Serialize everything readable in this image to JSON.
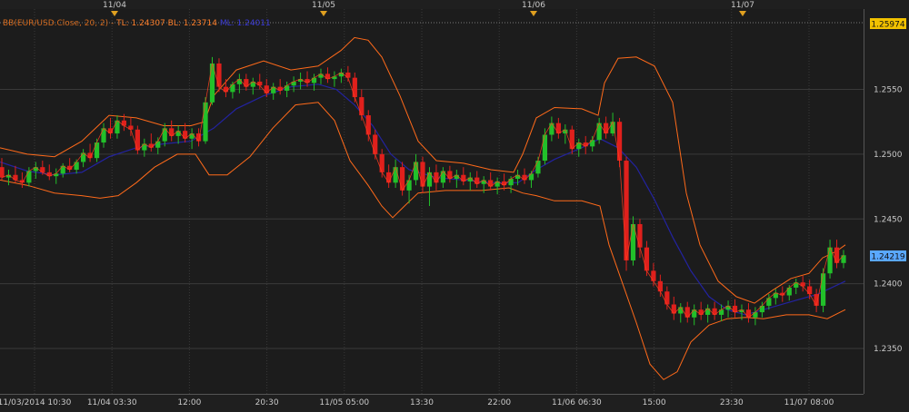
{
  "window": {
    "background": "#1f1f1f",
    "plot_background": "#1c1c1c",
    "grid_color": "#3a3a3a"
  },
  "legend": {
    "prefix": "BB(EUR/USD.Close, 20, 2)",
    "tl_label": "TL: 1.24307",
    "bl_label": "BL: 1.23714",
    "ml_label": "ML: 1.24011",
    "colors": {
      "prefix": "#d2691e",
      "tl": "#ff7f2a",
      "bl": "#ff7f2a",
      "ml": "#3b3bd9"
    }
  },
  "top_date_markers": [
    "11/04",
    "11/05",
    "11/06",
    "11/07"
  ],
  "price_badges": {
    "top": "1.25974",
    "last": "1.24219",
    "top_color": "#f2c200",
    "last_color": "#5aa8ff"
  },
  "chart_data": {
    "type": "candlestick",
    "title": "",
    "ylim": [
      1.2315,
      1.2612
    ],
    "y_ticks": [
      "1.2550",
      "1.2500",
      "1.2450",
      "1.2400",
      "1.2350"
    ],
    "x_ticks": [
      "11/03/2014 10:30",
      "11/04 03:30",
      "12:00",
      "20:30",
      "11/05 05:00",
      "13:30",
      "22:00",
      "11/06 06:30",
      "15:00",
      "23:30",
      "11/07 08:00"
    ],
    "up_color": "#22c02a",
    "down_color": "#e0201c",
    "upper_band_color": "#ff6a1a",
    "lower_band_color": "#ff6a1a",
    "mid_band_color": "#2323a0",
    "price_line_color": "#ff4020",
    "candles": [
      [
        1.249,
        1.2497,
        1.248,
        1.2482
      ],
      [
        1.2482,
        1.2488,
        1.2476,
        1.2484
      ],
      [
        1.2484,
        1.2491,
        1.2478,
        1.248
      ],
      [
        1.248,
        1.2486,
        1.2474,
        1.2478
      ],
      [
        1.2478,
        1.249,
        1.2475,
        1.2487
      ],
      [
        1.2487,
        1.2494,
        1.2481,
        1.249
      ],
      [
        1.249,
        1.2495,
        1.2484,
        1.2486
      ],
      [
        1.2486,
        1.2492,
        1.248,
        1.2483
      ],
      [
        1.2483,
        1.2489,
        1.2477,
        1.2485
      ],
      [
        1.2485,
        1.2493,
        1.2482,
        1.2491
      ],
      [
        1.2491,
        1.2497,
        1.2486,
        1.2488
      ],
      [
        1.2488,
        1.2496,
        1.2485,
        1.2494
      ],
      [
        1.2494,
        1.2504,
        1.249,
        1.2501
      ],
      [
        1.2501,
        1.2508,
        1.2494,
        1.2497
      ],
      [
        1.2497,
        1.2512,
        1.2494,
        1.2509
      ],
      [
        1.2509,
        1.2524,
        1.2505,
        1.252
      ],
      [
        1.252,
        1.2528,
        1.2512,
        1.2516
      ],
      [
        1.2516,
        1.253,
        1.2512,
        1.2526
      ],
      [
        1.2526,
        1.2531,
        1.2518,
        1.2522
      ],
      [
        1.2522,
        1.2528,
        1.2514,
        1.2519
      ],
      [
        1.2519,
        1.2522,
        1.25,
        1.2503
      ],
      [
        1.2503,
        1.2512,
        1.2498,
        1.2508
      ],
      [
        1.2508,
        1.2516,
        1.2502,
        1.2505
      ],
      [
        1.2505,
        1.2513,
        1.25,
        1.251
      ],
      [
        1.251,
        1.2524,
        1.2506,
        1.252
      ],
      [
        1.252,
        1.2526,
        1.251,
        1.2514
      ],
      [
        1.2514,
        1.2522,
        1.2508,
        1.2518
      ],
      [
        1.2518,
        1.2524,
        1.2509,
        1.2512
      ],
      [
        1.2512,
        1.252,
        1.2504,
        1.2516
      ],
      [
        1.2516,
        1.252,
        1.2506,
        1.251
      ],
      [
        1.251,
        1.2544,
        1.2508,
        1.254
      ],
      [
        1.254,
        1.2575,
        1.2538,
        1.257
      ],
      [
        1.257,
        1.2574,
        1.2548,
        1.2552
      ],
      [
        1.2552,
        1.2558,
        1.2544,
        1.2548
      ],
      [
        1.2548,
        1.2556,
        1.2543,
        1.2554
      ],
      [
        1.2554,
        1.2562,
        1.2547,
        1.2558
      ],
      [
        1.2558,
        1.2562,
        1.2549,
        1.2552
      ],
      [
        1.2552,
        1.2559,
        1.2546,
        1.2556
      ],
      [
        1.2556,
        1.2562,
        1.255,
        1.2553
      ],
      [
        1.2553,
        1.2558,
        1.2544,
        1.2547
      ],
      [
        1.2547,
        1.2555,
        1.2542,
        1.2552
      ],
      [
        1.2552,
        1.2558,
        1.2546,
        1.2549
      ],
      [
        1.2549,
        1.2556,
        1.2544,
        1.2553
      ],
      [
        1.2553,
        1.256,
        1.2548,
        1.2556
      ],
      [
        1.2556,
        1.2563,
        1.255,
        1.2558
      ],
      [
        1.2558,
        1.2564,
        1.2552,
        1.2555
      ],
      [
        1.2555,
        1.2562,
        1.2549,
        1.2559
      ],
      [
        1.2559,
        1.2566,
        1.2554,
        1.2562
      ],
      [
        1.2562,
        1.2567,
        1.2555,
        1.2558
      ],
      [
        1.2558,
        1.2564,
        1.2552,
        1.256
      ],
      [
        1.256,
        1.2566,
        1.2555,
        1.2563
      ],
      [
        1.2563,
        1.2568,
        1.2556,
        1.2559
      ],
      [
        1.2559,
        1.2563,
        1.254,
        1.2544
      ],
      [
        1.2544,
        1.255,
        1.2526,
        1.253
      ],
      [
        1.253,
        1.2534,
        1.251,
        1.2515
      ],
      [
        1.2515,
        1.2519,
        1.2496,
        1.25
      ],
      [
        1.25,
        1.2504,
        1.2482,
        1.2486
      ],
      [
        1.2486,
        1.2492,
        1.2474,
        1.2478
      ],
      [
        1.2478,
        1.2496,
        1.2474,
        1.249
      ],
      [
        1.249,
        1.2494,
        1.2468,
        1.2472
      ],
      [
        1.2472,
        1.2484,
        1.2462,
        1.248
      ],
      [
        1.248,
        1.25,
        1.2476,
        1.2494
      ],
      [
        1.2494,
        1.2498,
        1.247,
        1.2475
      ],
      [
        1.2475,
        1.249,
        1.246,
        1.2486
      ],
      [
        1.2486,
        1.2492,
        1.2472,
        1.2478
      ],
      [
        1.2478,
        1.249,
        1.2474,
        1.2487
      ],
      [
        1.2487,
        1.2491,
        1.2478,
        1.2481
      ],
      [
        1.2481,
        1.2488,
        1.2474,
        1.2484
      ],
      [
        1.2484,
        1.249,
        1.2476,
        1.2479
      ],
      [
        1.2479,
        1.2486,
        1.2472,
        1.2482
      ],
      [
        1.2482,
        1.2487,
        1.2474,
        1.2477
      ],
      [
        1.2477,
        1.2483,
        1.247,
        1.248
      ],
      [
        1.248,
        1.2486,
        1.2472,
        1.2475
      ],
      [
        1.2475,
        1.2482,
        1.2469,
        1.2479
      ],
      [
        1.2479,
        1.2485,
        1.2472,
        1.2476
      ],
      [
        1.2476,
        1.2483,
        1.247,
        1.2481
      ],
      [
        1.2481,
        1.2488,
        1.2476,
        1.2484
      ],
      [
        1.2484,
        1.2489,
        1.2477,
        1.248
      ],
      [
        1.248,
        1.2487,
        1.2474,
        1.2485
      ],
      [
        1.2485,
        1.2498,
        1.2482,
        1.2495
      ],
      [
        1.2495,
        1.252,
        1.2492,
        1.2515
      ],
      [
        1.2515,
        1.2529,
        1.251,
        1.2524
      ],
      [
        1.2524,
        1.2528,
        1.2512,
        1.2516
      ],
      [
        1.2516,
        1.2523,
        1.2508,
        1.2519
      ],
      [
        1.2519,
        1.2522,
        1.25,
        1.2504
      ],
      [
        1.2504,
        1.2512,
        1.2498,
        1.2509
      ],
      [
        1.2509,
        1.2514,
        1.25,
        1.2506
      ],
      [
        1.2506,
        1.2514,
        1.2502,
        1.2511
      ],
      [
        1.2511,
        1.2528,
        1.2508,
        1.2524
      ],
      [
        1.2524,
        1.2529,
        1.2512,
        1.2516
      ],
      [
        1.2516,
        1.2532,
        1.2514,
        1.2525
      ],
      [
        1.2525,
        1.2528,
        1.249,
        1.2495
      ],
      [
        1.2495,
        1.2498,
        1.241,
        1.2418
      ],
      [
        1.2418,
        1.2452,
        1.2414,
        1.2446
      ],
      [
        1.2446,
        1.245,
        1.242,
        1.2428
      ],
      [
        1.2428,
        1.2433,
        1.2406,
        1.241
      ],
      [
        1.241,
        1.2416,
        1.2398,
        1.2402
      ],
      [
        1.2402,
        1.2407,
        1.239,
        1.2394
      ],
      [
        1.2394,
        1.2398,
        1.238,
        1.2384
      ],
      [
        1.2384,
        1.239,
        1.2372,
        1.2377
      ],
      [
        1.2377,
        1.2385,
        1.237,
        1.2382
      ],
      [
        1.2382,
        1.2386,
        1.237,
        1.2374
      ],
      [
        1.2374,
        1.2384,
        1.2368,
        1.238
      ],
      [
        1.238,
        1.2386,
        1.2372,
        1.2376
      ],
      [
        1.2376,
        1.2384,
        1.237,
        1.2381
      ],
      [
        1.2381,
        1.2386,
        1.2372,
        1.2376
      ],
      [
        1.2376,
        1.2384,
        1.2371,
        1.238
      ],
      [
        1.238,
        1.2387,
        1.2374,
        1.2383
      ],
      [
        1.2383,
        1.2388,
        1.2374,
        1.2378
      ],
      [
        1.2378,
        1.2384,
        1.2372,
        1.238
      ],
      [
        1.238,
        1.2385,
        1.237,
        1.2374
      ],
      [
        1.2374,
        1.2382,
        1.2368,
        1.2378
      ],
      [
        1.2378,
        1.2386,
        1.2374,
        1.2383
      ],
      [
        1.2383,
        1.2392,
        1.238,
        1.2389
      ],
      [
        1.2389,
        1.2396,
        1.2384,
        1.2393
      ],
      [
        1.2393,
        1.2398,
        1.2386,
        1.2391
      ],
      [
        1.2391,
        1.2399,
        1.2387,
        1.2397
      ],
      [
        1.2397,
        1.2404,
        1.2392,
        1.2401
      ],
      [
        1.2401,
        1.2406,
        1.2394,
        1.2398
      ],
      [
        1.2398,
        1.2403,
        1.2388,
        1.2392
      ],
      [
        1.2392,
        1.2396,
        1.2378,
        1.2383
      ],
      [
        1.2383,
        1.2412,
        1.2378,
        1.2408
      ],
      [
        1.2408,
        1.2434,
        1.2404,
        1.2428
      ],
      [
        1.2428,
        1.2434,
        1.2412,
        1.2416
      ],
      [
        1.2416,
        1.2426,
        1.2412,
        1.2422
      ]
    ],
    "upper_band": [
      [
        0,
        1.2505
      ],
      [
        30,
        1.25
      ],
      [
        60,
        1.2498
      ],
      [
        90,
        1.251
      ],
      [
        120,
        1.253
      ],
      [
        150,
        1.2528
      ],
      [
        180,
        1.2522
      ],
      [
        210,
        1.2522
      ],
      [
        225,
        1.2525
      ],
      [
        235,
        1.2545
      ],
      [
        260,
        1.2565
      ],
      [
        290,
        1.2572
      ],
      [
        320,
        1.2565
      ],
      [
        350,
        1.2568
      ],
      [
        375,
        1.258
      ],
      [
        390,
        1.259
      ],
      [
        405,
        1.2588
      ],
      [
        420,
        1.2575
      ],
      [
        440,
        1.2545
      ],
      [
        460,
        1.251
      ],
      [
        480,
        1.2495
      ],
      [
        510,
        1.2493
      ],
      [
        540,
        1.2488
      ],
      [
        565,
        1.2486
      ],
      [
        575,
        1.25
      ],
      [
        590,
        1.2528
      ],
      [
        610,
        1.2536
      ],
      [
        640,
        1.2535
      ],
      [
        658,
        1.253
      ],
      [
        665,
        1.2555
      ],
      [
        680,
        1.2574
      ],
      [
        700,
        1.2575
      ],
      [
        720,
        1.2568
      ],
      [
        740,
        1.254
      ],
      [
        755,
        1.247
      ],
      [
        770,
        1.243
      ],
      [
        790,
        1.2402
      ],
      [
        810,
        1.239
      ],
      [
        830,
        1.2385
      ],
      [
        850,
        1.2395
      ],
      [
        870,
        1.2404
      ],
      [
        890,
        1.2408
      ],
      [
        905,
        1.242
      ],
      [
        920,
        1.2425
      ],
      [
        930,
        1.243
      ]
    ],
    "lower_band": [
      [
        0,
        1.248
      ],
      [
        30,
        1.2476
      ],
      [
        60,
        1.247
      ],
      [
        90,
        1.2468
      ],
      [
        110,
        1.2466
      ],
      [
        130,
        1.2468
      ],
      [
        150,
        1.2478
      ],
      [
        170,
        1.249
      ],
      [
        195,
        1.25
      ],
      [
        215,
        1.25
      ],
      [
        230,
        1.2484
      ],
      [
        250,
        1.2484
      ],
      [
        275,
        1.2498
      ],
      [
        300,
        1.252
      ],
      [
        325,
        1.2538
      ],
      [
        350,
        1.254
      ],
      [
        368,
        1.2526
      ],
      [
        385,
        1.2495
      ],
      [
        405,
        1.2476
      ],
      [
        420,
        1.246
      ],
      [
        432,
        1.2451
      ],
      [
        445,
        1.246
      ],
      [
        460,
        1.247
      ],
      [
        490,
        1.2472
      ],
      [
        530,
        1.2472
      ],
      [
        560,
        1.2474
      ],
      [
        575,
        1.247
      ],
      [
        590,
        1.2468
      ],
      [
        610,
        1.2464
      ],
      [
        640,
        1.2464
      ],
      [
        660,
        1.246
      ],
      [
        670,
        1.243
      ],
      [
        685,
        1.24
      ],
      [
        700,
        1.237
      ],
      [
        715,
        1.2338
      ],
      [
        730,
        1.2326
      ],
      [
        745,
        1.2332
      ],
      [
        760,
        1.2355
      ],
      [
        780,
        1.2368
      ],
      [
        800,
        1.2373
      ],
      [
        820,
        1.2374
      ],
      [
        840,
        1.2373
      ],
      [
        865,
        1.2376
      ],
      [
        890,
        1.2376
      ],
      [
        910,
        1.2373
      ],
      [
        930,
        1.238
      ]
    ],
    "mid_band": [
      [
        0,
        1.2494
      ],
      [
        30,
        1.2487
      ],
      [
        60,
        1.2484
      ],
      [
        90,
        1.2486
      ],
      [
        120,
        1.2498
      ],
      [
        150,
        1.2505
      ],
      [
        180,
        1.2508
      ],
      [
        210,
        1.251
      ],
      [
        235,
        1.252
      ],
      [
        260,
        1.2535
      ],
      [
        290,
        1.2545
      ],
      [
        320,
        1.2552
      ],
      [
        350,
        1.2554
      ],
      [
        370,
        1.255
      ],
      [
        390,
        1.2538
      ],
      [
        410,
        1.2522
      ],
      [
        430,
        1.25
      ],
      [
        450,
        1.2488
      ],
      [
        480,
        1.2482
      ],
      [
        510,
        1.248
      ],
      [
        540,
        1.2478
      ],
      [
        570,
        1.2478
      ],
      [
        590,
        1.2488
      ],
      [
        610,
        1.2496
      ],
      [
        640,
        1.2505
      ],
      [
        660,
        1.2512
      ],
      [
        680,
        1.2505
      ],
      [
        700,
        1.249
      ],
      [
        720,
        1.2465
      ],
      [
        740,
        1.2436
      ],
      [
        760,
        1.241
      ],
      [
        780,
        1.239
      ],
      [
        800,
        1.238
      ],
      [
        820,
        1.2376
      ],
      [
        840,
        1.238
      ],
      [
        870,
        1.2386
      ],
      [
        900,
        1.2392
      ],
      [
        930,
        1.2402
      ]
    ]
  }
}
